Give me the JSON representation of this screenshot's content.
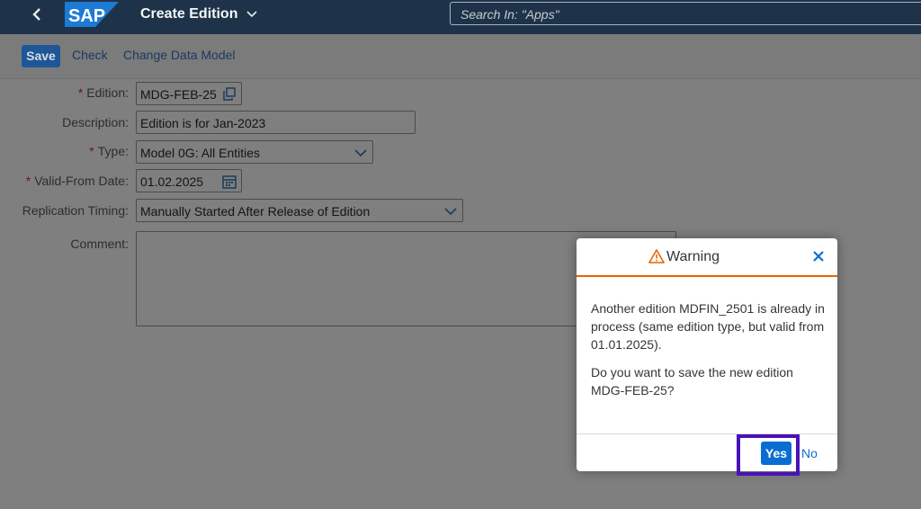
{
  "shell": {
    "logo_text": "SAP",
    "app_title": "Create Edition",
    "search_placeholder": "Search In: \"Apps\"",
    "colors": {
      "header_bg": "#1e3349",
      "brand": "#0a6ed1"
    }
  },
  "toolbar": {
    "save_label": "Save",
    "check_label": "Check",
    "change_model_label": "Change Data Model"
  },
  "form": {
    "edition": {
      "label": "Edition:",
      "required": "*",
      "value": "MDG-FEB-25"
    },
    "description": {
      "label": "Description:",
      "value": "Edition is for Jan-2023"
    },
    "type": {
      "label": "Type:",
      "required": "*",
      "value": "Model 0G: All Entities"
    },
    "valid_from": {
      "label": "Valid-From Date:",
      "required": "*",
      "value": "01.02.2025"
    },
    "replication": {
      "label": "Replication Timing:",
      "value": "Manually Started After Release of Edition"
    },
    "comment": {
      "label": "Comment:",
      "value": ""
    }
  },
  "dialog": {
    "title": "Warning",
    "message_1": "Another edition MDFIN_2501 is already in process (same edition type, but valid from 01.01.2025).",
    "message_2": "Do you want to save the new edition MDG-FEB-25?",
    "yes_label": "Yes",
    "no_label": "No",
    "colors": {
      "accent": "#e76500",
      "highlight": "#4a12b8"
    }
  }
}
